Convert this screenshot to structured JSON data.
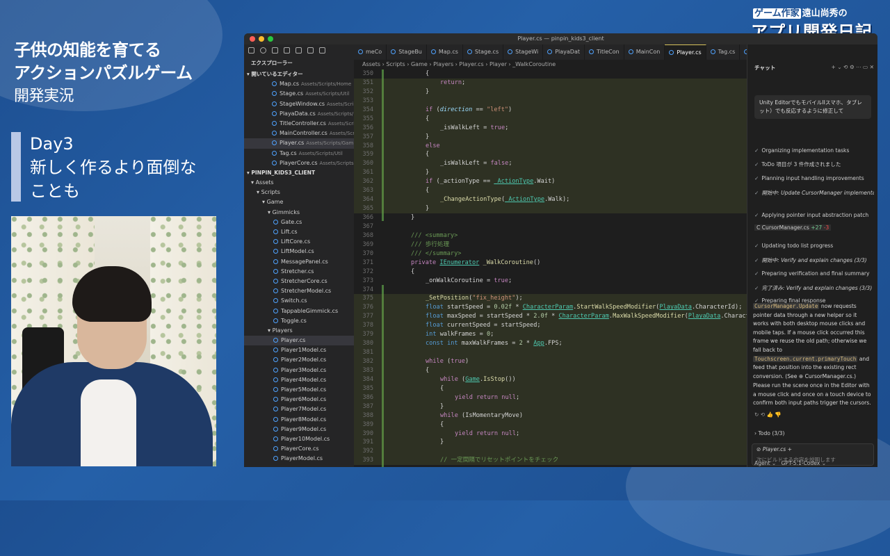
{
  "overlay": {
    "title_line1": "子供の知能を育てる",
    "title_line2": "アクションパズルゲーム",
    "title_line3": "開発実況",
    "day": "Day3",
    "day_line2": "新しく作るより面倒な",
    "day_line3": "ことも"
  },
  "logo": {
    "tag1": "ゲーム作家",
    "name": "遠山尚秀の",
    "main": "アプリ開発日記"
  },
  "window": {
    "title": "Player.cs — pinpin_kids3_client"
  },
  "explorer": {
    "header": "エクスプローラー",
    "open_editors": "開いているエディター",
    "open_files": [
      {
        "name": "Map.cs",
        "path": "Assets/Scripts/Home"
      },
      {
        "name": "Stage.cs",
        "path": "Assets/Scripts/Util"
      },
      {
        "name": "StageWindow.cs",
        "path": "Assets/Scri..."
      },
      {
        "name": "PlayaData.cs",
        "path": "Assets/Scripts/..."
      },
      {
        "name": "TitleController.cs",
        "path": "Assets/Scri..."
      },
      {
        "name": "MainController.cs",
        "path": "Assets/Scr..."
      },
      {
        "name": "Player.cs",
        "path": "Assets/Scripts/Gam..."
      },
      {
        "name": "Tag.cs",
        "path": "Assets/Scripts/Util"
      },
      {
        "name": "PlayerCore.cs",
        "path": "Assets/Scripts..."
      }
    ],
    "project": "PINPIN_KIDS3_CLIENT",
    "folders": [
      "Assets",
      "Scripts",
      "Game",
      "Gimmicks"
    ],
    "gimmick_files": [
      "Gate.cs",
      "Lift.cs",
      "LiftCore.cs",
      "LiftModel.cs",
      "MessagePanel.cs",
      "Stretcher.cs",
      "StretcherCore.cs",
      "StretcherModel.cs",
      "Switch.cs",
      "TappableGimmick.cs",
      "Toggle.cs"
    ],
    "players_folder": "Players",
    "player_files": [
      "Player.cs",
      "Player1Model.cs",
      "Player2Model.cs",
      "Player3Model.cs",
      "Player4Model.cs",
      "Player5Model.cs",
      "Player6Model.cs",
      "Player7Model.cs",
      "Player8Model.cs",
      "Player9Model.cs",
      "Player10Model.cs",
      "PlayerCore.cs",
      "PlayerModel.cs"
    ]
  },
  "tabs": [
    "meCo",
    "StageBu",
    "Map.cs",
    "Stage.cs",
    "StageWi",
    "PlayaDat",
    "TitleCon",
    "MainCon",
    "Player.cs",
    "Tag.cs",
    "PlayerCo"
  ],
  "breadcrumb": "Assets › Scripts › Game › Players › Player.cs › Player › _WalkCoroutine",
  "code": {
    "line_numbers": [
      "350",
      "351",
      "352",
      "353",
      "354",
      "355",
      "356",
      "357",
      "358",
      "359",
      "360",
      "361",
      "362",
      "363",
      "364",
      "365",
      "366",
      "367",
      "368",
      "369",
      "370",
      "371",
      "372",
      "373",
      "374",
      "375",
      "376",
      "377",
      "378",
      "379",
      "380",
      "381",
      "382",
      "383",
      "384",
      "385",
      "386",
      "387",
      "388",
      "389",
      "390",
      "391",
      "392",
      "393"
    ],
    "lines": [
      "{",
      "return;",
      "}",
      "",
      "if (direction == \"left\")",
      "{",
      "_isWalkLeft = true;",
      "}",
      "else",
      "{",
      "_isWalkLeft = false;",
      "}",
      "if (_actionType == _ActionType.Wait)",
      "{",
      "_ChangeActionType(_ActionType.Walk);",
      "}",
      "}",
      "",
      "/// <summary>",
      "/// 歩行処理",
      "/// </summary>",
      "private IEnumerator _WalkCoroutine()",
      "{",
      "_onWalkCoroutine = true;",
      "",
      "_SetPosition(\"fix_height\");",
      "float startSpeed = 0.02f * CharacterParam.StartWalkSpeedModifier(PlayaData.CharacterId);",
      "float maxSpeed = startSpeed * 2.0f * CharacterParam.MaxWalkSpeedModifier(PlayaData.Charact",
      "float currentSpeed = startSpeed;",
      "int walkFrames = 0;",
      "const int maxWalkFrames = 2 * App.FPS;",
      "",
      "while (true)",
      "{",
      "while (Game.IsStop())",
      "{",
      "yield return null;",
      "}",
      "while (IsMomentaryMove)",
      "{",
      "yield return null;",
      "}",
      "",
      "// 一定間隔でリセットポイントをチェック"
    ]
  },
  "chat": {
    "header": "チャット",
    "user_message": "Unity EditorでもモバイルIIスマホ、タブレット）でも反応するように修正して",
    "steps": [
      "Organizing implementation tasks",
      "ToDo 項目が 3 件作成されました",
      "Planning input handling improvements",
      "開始中: Update CursorManager implementation (2/3)",
      "Applying pointer input abstraction patch",
      "CursorManager.cs +27 -3",
      "Updating todo list progress",
      "開始中: Verify and explain changes (3/3)",
      "Preparing verification and final summary",
      "完了済み: Verify and explain changes (3/3)",
      "Preparing final response"
    ],
    "response1_code": "CursorManager.Update",
    "response1": " now requests pointer data through a new helper so it works with both desktop mouse clicks and mobile taps. If a mouse click occurred this frame we reuse the old path; otherwise we fall back to ",
    "response1_code2": "Touchscreen.current.primaryTouch",
    "response1_tail": " and feed that position into the existing rect conversion. (See ",
    "response1_file": "CursorManager.cs",
    "response1_end": ".)",
    "response2": "Please run the scene once in the Editor with a mouse click and once on a touch device to confirm both input paths trigger the cursors.",
    "todo": "Todo (3/3)",
    "context_file": "Player.cs",
    "input_placeholder": "次にビルドする内容を説明します",
    "mode": "Agent",
    "model": "GPT-5.1-Codex"
  }
}
